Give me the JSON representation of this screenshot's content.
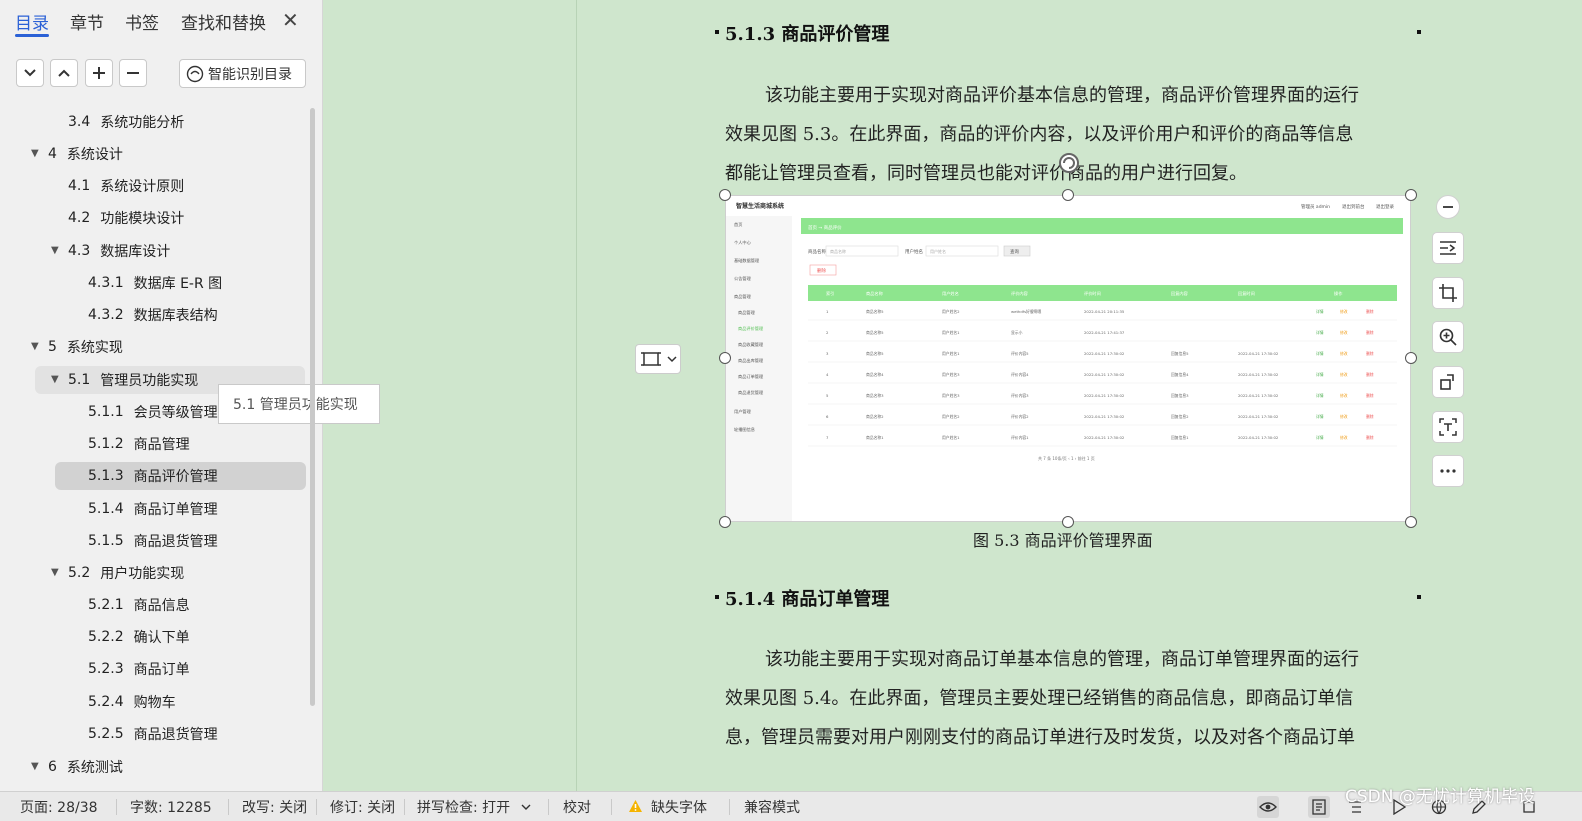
{
  "sidebar": {
    "tabs": [
      "目录",
      "章节",
      "书签",
      "查找和替换"
    ],
    "smart_label": "智能识别目录",
    "tooltip": "5.1 管理员功能实现",
    "toc": [
      {
        "num": "3.4",
        "label": "系统功能分析"
      },
      {
        "num": "4",
        "label": "系统设计"
      },
      {
        "num": "4.1",
        "label": "系统设计原则"
      },
      {
        "num": "4.2",
        "label": "功能模块设计"
      },
      {
        "num": "4.3",
        "label": "数据库设计"
      },
      {
        "num": "4.3.1",
        "label": "数据库 E-R 图"
      },
      {
        "num": "4.3.2",
        "label": "数据库表结构"
      },
      {
        "num": "5",
        "label": "系统实现"
      },
      {
        "num": "5.1",
        "label": "管理员功能实现"
      },
      {
        "num": "5.1.1",
        "label": "会员等级管理"
      },
      {
        "num": "5.1.2",
        "label": "商品管理"
      },
      {
        "num": "5.1.3",
        "label": "商品评价管理"
      },
      {
        "num": "5.1.4",
        "label": "商品订单管理"
      },
      {
        "num": "5.1.5",
        "label": "商品退货管理"
      },
      {
        "num": "5.2",
        "label": "用户功能实现"
      },
      {
        "num": "5.2.1",
        "label": "商品信息"
      },
      {
        "num": "5.2.2",
        "label": "确认下单"
      },
      {
        "num": "5.2.3",
        "label": "商品订单"
      },
      {
        "num": "5.2.4",
        "label": "购物车"
      },
      {
        "num": "5.2.5",
        "label": "商品退货管理"
      },
      {
        "num": "6",
        "label": "系统测试"
      }
    ]
  },
  "document": {
    "h1": "5.1.3 商品评价管理",
    "p1_a": "该功能主要用于实现对商品评价基本信息的管理，商品评价管理界面的运行",
    "p1_b": "效果见图 5.3。在此界面，商品的评价内容，以及评价用户和评价的商品等信息",
    "p1_c": "都能让管理员查看，同时管理员也能对评价商品的用户进行回复。",
    "caption": "图 5.3 商品评价管理界面",
    "h2": "5.1.4 商品订单管理",
    "p2_a": "该功能主要用于实现对商品订单基本信息的管理，商品订单管理界面的运行",
    "p2_b": "效果见图 5.4。在此界面，管理员主要处理已经销售的商品信息，即商品订单信",
    "p2_c": "息，管理员需要对用户刚刚支付的商品订单进行及时发货，以及对各个商品订单"
  },
  "embedded": {
    "app_title": "智慧生活商城系统",
    "top_right": [
      "管理员 admin",
      "退出到前台",
      "退出登录"
    ],
    "side_menu": [
      "首页",
      "个人中心",
      "基础数据管理",
      "公告管理",
      "商品管理",
      "商品管理",
      "商品评价管理",
      "商品收藏管理",
      "商品出库管理",
      "商品订单管理",
      "商品退货管理",
      "用户管理",
      "轮播图信息"
    ],
    "breadcrumb": "首页 → 商品评价",
    "search_label1": "商品名称",
    "search_ph1": "商品名称",
    "search_label2": "用户姓名",
    "search_ph2": "用户姓名",
    "search_btn": "查询",
    "delete_btn": "删除",
    "columns": [
      "",
      "索引",
      "商品名称",
      "用户姓名",
      "评价内容",
      "评价时间",
      "回复内容",
      "回复时间",
      "操作"
    ],
    "rows": [
      [
        "1",
        "商品名称5",
        "用户姓名2",
        "wethdfs好傻啊嗯",
        "2022-04-21 20:11:35",
        "",
        ""
      ],
      [
        "2",
        "商品名称5",
        "用户姓名1",
        "显示小",
        "2022-04-21 17:41:37",
        "",
        ""
      ],
      [
        "3",
        "商品名称5",
        "用户姓名1",
        "评价内容5",
        "2022-04-21 17:30:02",
        "回复信息5",
        "2022-04-21 17:30:02"
      ],
      [
        "4",
        "商品名称4",
        "用户姓名3",
        "评价内容4",
        "2022-04-21 17:30:02",
        "回复信息4",
        "2022-04-21 17:30:02"
      ],
      [
        "5",
        "商品名称3",
        "用户姓名3",
        "评价内容3",
        "2022-04-21 17:30:02",
        "回复信息3",
        "2022-04-21 17:30:02"
      ],
      [
        "6",
        "商品名称2",
        "用户姓名2",
        "评价内容2",
        "2022-04-21 17:30:02",
        "回复信息2",
        "2022-04-21 17:30:02"
      ],
      [
        "7",
        "商品名称1",
        "用户姓名1",
        "评价内容1",
        "2022-04-21 17:30:02",
        "回复信息1",
        "2022-04-21 17:30:02"
      ]
    ],
    "ops": [
      "详情",
      "修改",
      "删除"
    ],
    "pager": "共 7 条   10条/页   ‹   1   ›   前往   1   页"
  },
  "status": {
    "page": "页面: 28/38",
    "words": "字数: 12285",
    "revise": "改写: 关闭",
    "track": "修订: 关闭",
    "spell": "拼写检查: 打开",
    "proof": "校对",
    "missing_font": "缺失字体",
    "compat": "兼容模式",
    "watermark": "CSDN @无忧计算机毕设"
  },
  "colors": {
    "accent": "#2b61d6",
    "page_bg": "#cfe6cd",
    "embedded_green": "#8ee58e"
  }
}
